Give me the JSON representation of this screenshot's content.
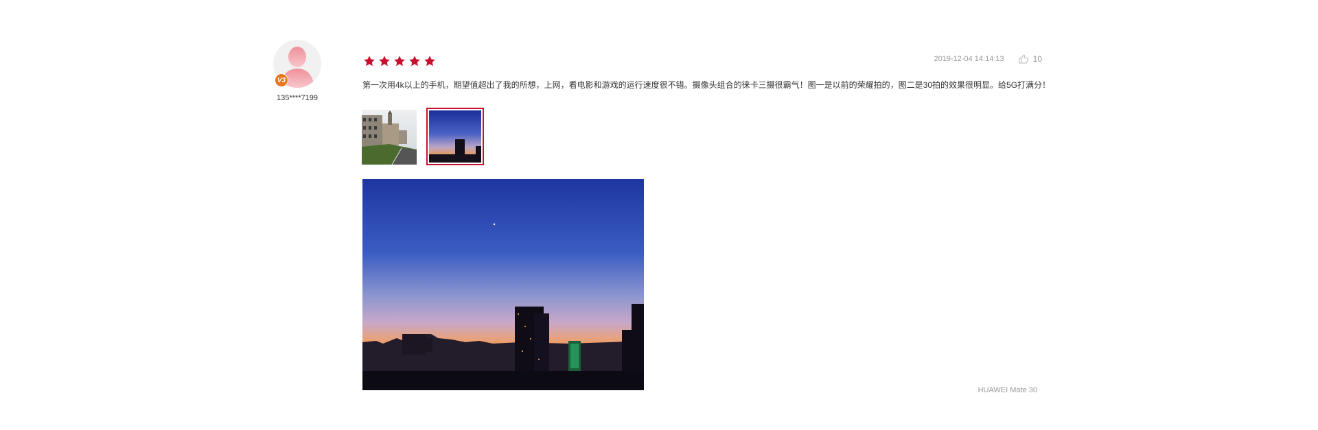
{
  "review": {
    "user": {
      "name": "135****7199",
      "level_badge": "V3"
    },
    "rating": {
      "value": 5,
      "max": 5,
      "color": "#c8102e"
    },
    "date": "2019-12-04 14:14:13",
    "likes": "10",
    "text": "第一次用4k以上的手机，期望值超出了我的所想，上网，看电影和游戏的运行速度很不错。摄像头组合的徕卡三摄很霸气！图一是以前的荣耀拍的，图二是30拍的效果很明显。给5G打满分！",
    "thumbnails": [
      {
        "id": "photo-1",
        "selected": false
      },
      {
        "id": "photo-2",
        "selected": true
      }
    ],
    "device": "HUAWEI Mate 30"
  },
  "colors": {
    "accent": "#c8102e",
    "badge": "#e8761e",
    "muted": "#999999"
  },
  "icons": {
    "like": "thumbs-up-icon",
    "star": "star-icon"
  }
}
